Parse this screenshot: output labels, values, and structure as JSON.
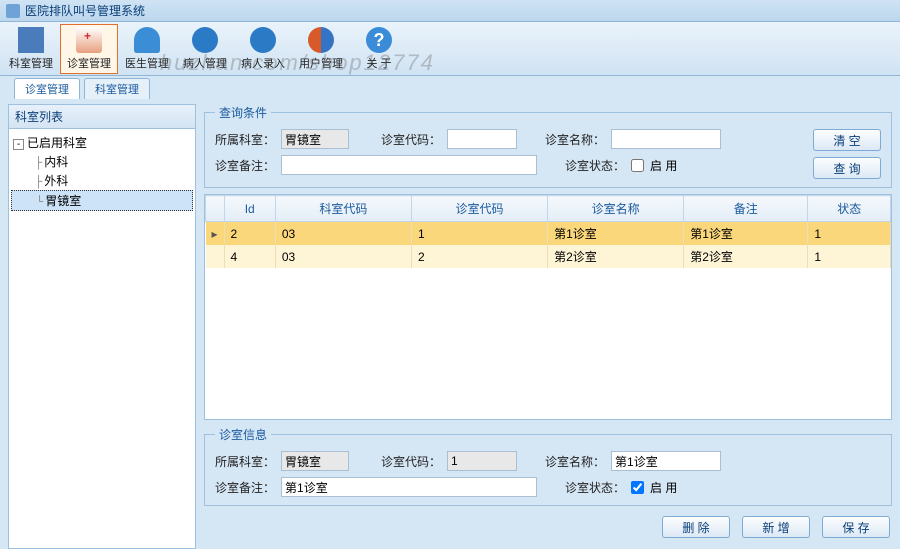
{
  "app": {
    "title": "医院排队叫号管理系统"
  },
  "toolbar": {
    "items": [
      {
        "label": "科室管理"
      },
      {
        "label": "诊室管理"
      },
      {
        "label": "医生管理"
      },
      {
        "label": "病人管理"
      },
      {
        "label": "病人录入"
      },
      {
        "label": "用户管理"
      },
      {
        "label": "关 于"
      }
    ]
  },
  "tabs": {
    "active": "诊室管理",
    "other": "科室管理"
  },
  "tree": {
    "title": "科室列表",
    "root": "已启用科室",
    "children": [
      "内科",
      "外科",
      "胃镜室"
    ],
    "selected": "胃镜室"
  },
  "query": {
    "legend": "查询条件",
    "dept_label": "所属科室：",
    "dept_value": "胃镜室",
    "code_label": "诊室代码：",
    "code_value": "",
    "name_label": "诊室名称：",
    "name_value": "",
    "remark_label": "诊室备注：",
    "remark_value": "",
    "state_label": "诊室状态：",
    "state_cb_label": "启 用",
    "btn_clear": "清 空",
    "btn_query": "查 询"
  },
  "grid": {
    "cols": [
      "Id",
      "科室代码",
      "诊室代码",
      "诊室名称",
      "备注",
      "状态"
    ],
    "rows": [
      {
        "id": "2",
        "dept": "03",
        "code": "1",
        "name": "第1诊室",
        "remark": "第1诊室",
        "state": "1",
        "sel": true
      },
      {
        "id": "4",
        "dept": "03",
        "code": "2",
        "name": "第2诊室",
        "remark": "第2诊室",
        "state": "1",
        "sel": false
      }
    ]
  },
  "detail": {
    "legend": "诊室信息",
    "dept_label": "所属科室：",
    "dept_value": "胃镜室",
    "code_label": "诊室代码：",
    "code_value": "1",
    "name_label": "诊室名称：",
    "name_value": "第1诊室",
    "remark_label": "诊室备注：",
    "remark_value": "第1诊室",
    "state_label": "诊室状态：",
    "state_cb_label": "启 用"
  },
  "buttons": {
    "delete": "删 除",
    "add": "新 增",
    "save": "保 存"
  },
  "watermark": "huzhan.com/shop12774"
}
